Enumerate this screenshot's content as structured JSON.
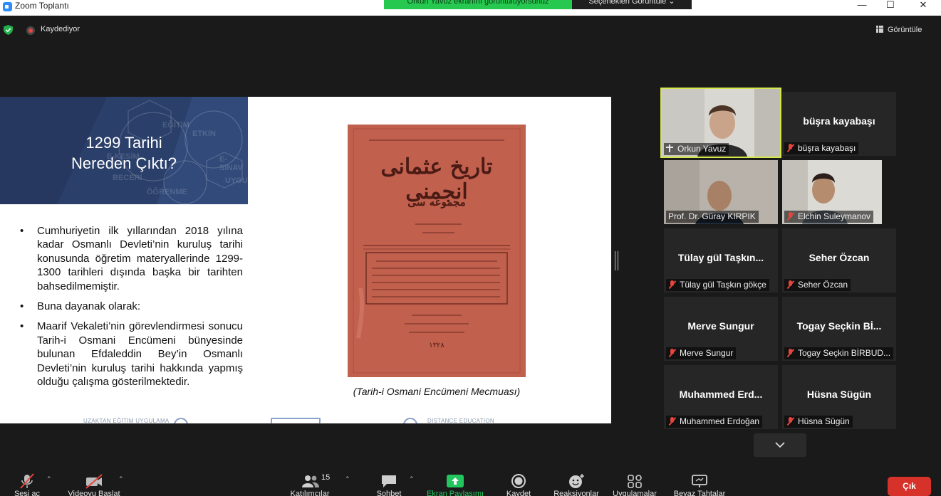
{
  "window": {
    "title": "Zoom Toplantı",
    "share_banner": "Orkun Yavuz ekranını görüntülüyorsunuz",
    "view_options": "Seçenekleri Görüntüle ⌄",
    "controls": {
      "minimize": "—",
      "maximize": "☐",
      "close": "✕"
    }
  },
  "meeting_bar": {
    "recording_label": "Kaydediyor",
    "view_label": "Görüntüle"
  },
  "slide": {
    "title_line1": "1299 Tarihi",
    "title_line2": "Nereden Çıktı?",
    "header_deco_words": [
      "EĞİTİM",
      "E-SINAV",
      "BECERİ",
      "ÖĞRENME",
      "UYGULA",
      "ETKİN",
      "E-KESİM"
    ],
    "bullets": [
      "Cumhuriyetin ilk yıllarından 2018 yılına kadar Osmanlı Devleti’nin kuruluş tarihi konusunda öğretim materyallerinde 1299-1300 tarihleri dışında başka bir tarihten bahsedilmemiştir.",
      "Buna dayanak olarak:",
      "Maarif Vekaleti’nin görevlendirmesi sonucu Tarih-i Osmani Encümeni bünyesinde bulunan Efdaleddin Bey’in Osmanlı Devleti’nin kuruluş tarihi hakkında yapmış olduğu çalışma gösterilmektedir."
    ],
    "document_title": "تاريخ عثمانى انجمنى",
    "document_subtitle": "مجموعه سى",
    "document_year": "١٣٢٨",
    "caption": "(Tarih-i Osmani Encümeni Mecmuası)",
    "footer_left": "UZAKTAN EĞİTİM UYGULAMA",
    "footer_right": "DISTANCE EDUCATION"
  },
  "participants": [
    {
      "name": "Orkun Yavuz",
      "video": true,
      "active": true,
      "muted": false,
      "pinned": true
    },
    {
      "name": "büşra kayabaşı",
      "center": "büşra kayabaşı",
      "video": false,
      "muted": true
    },
    {
      "name": "Prof. Dr. Güray KIRPIK",
      "video": true,
      "muted": false
    },
    {
      "name": "Elchin Suleymanov",
      "video": true,
      "muted": true
    },
    {
      "name": "Tülay gül Taşkın gökçe",
      "center": "Tülay gül Taşkın...",
      "video": false,
      "muted": true
    },
    {
      "name": "Seher Özcan",
      "center": "Seher Özcan",
      "video": false,
      "muted": true
    },
    {
      "name": "Merve Sungur",
      "center": "Merve Sungur",
      "video": false,
      "muted": true
    },
    {
      "name": "Togay Seçkin BİRBUD...",
      "center": "Togay Seçkin Bİ...",
      "video": false,
      "muted": true
    },
    {
      "name": "Muhammed Erdoğan",
      "center": "Muhammed Erd...",
      "video": false,
      "muted": true
    },
    {
      "name": "Hüsna Sügün",
      "center": "Hüsna Sügün",
      "video": false,
      "muted": true
    }
  ],
  "toolbar": {
    "mute": "Sesi aç",
    "video": "Videoyu Başlat",
    "participants": "Katılımcılar",
    "participants_count": "15",
    "chat": "Sohbet",
    "share": "Ekran Paylaşımı",
    "record": "Kaydet",
    "reactions": "Reaksiyonlar",
    "apps": "Uygulamalar",
    "whiteboard": "Beyaz Tahtalar",
    "end": "Çık"
  },
  "colors": {
    "share_banner": "#26c84f",
    "slide_header": "#2a3f6a",
    "document": "#c2604e",
    "active_speaker": "#d6e74b",
    "end_button": "#d7322a",
    "share_icon": "#22c55e"
  }
}
